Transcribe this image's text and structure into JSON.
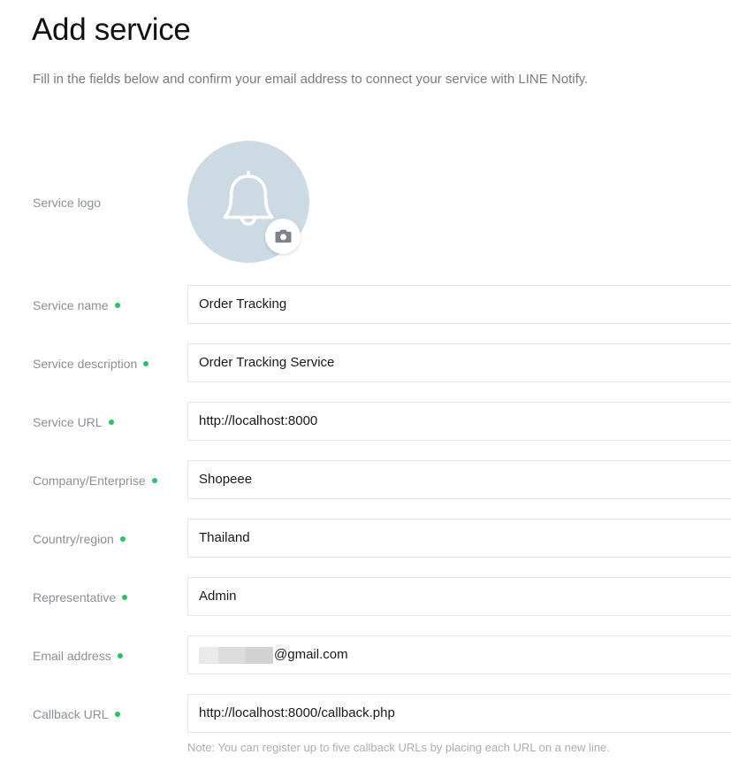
{
  "header": {
    "title": "Add service",
    "subtitle": "Fill in the fields below and confirm your email address to connect your service with LINE Notify."
  },
  "colors": {
    "required_dot": "#27c463",
    "logo_background": "#ccdae3",
    "label_text": "#8a9099",
    "input_border": "#e3e5e7",
    "note_text": "#a9aeb3"
  },
  "logo_field": {
    "label": "Service logo",
    "required": false,
    "icon": "bell-icon",
    "upload_icon": "camera-icon"
  },
  "fields": [
    {
      "label": "Service name",
      "required": true,
      "value": "Order Tracking",
      "redacted": false,
      "name": "service-name"
    },
    {
      "label": "Service description",
      "required": true,
      "value": "Order Tracking Service",
      "redacted": false,
      "name": "service-description"
    },
    {
      "label": "Service URL",
      "required": true,
      "value": "http://localhost:8000",
      "redacted": false,
      "name": "service-url"
    },
    {
      "label": "Company/Enterprise",
      "required": true,
      "value": "Shopeee",
      "redacted": false,
      "name": "company-enterprise"
    },
    {
      "label": "Country/region",
      "required": true,
      "value": "Thailand",
      "redacted": false,
      "name": "country-region"
    },
    {
      "label": "Representative",
      "required": true,
      "value": "Admin",
      "redacted": false,
      "name": "representative"
    },
    {
      "label": "Email address",
      "required": true,
      "value": "@gmail.com",
      "redacted": true,
      "name": "email-address"
    },
    {
      "label": "Callback URL",
      "required": true,
      "value": "http://localhost:8000/callback.php",
      "redacted": false,
      "name": "callback-url",
      "note": "Note: You can register up to five callback URLs by placing each URL on a new line."
    }
  ]
}
